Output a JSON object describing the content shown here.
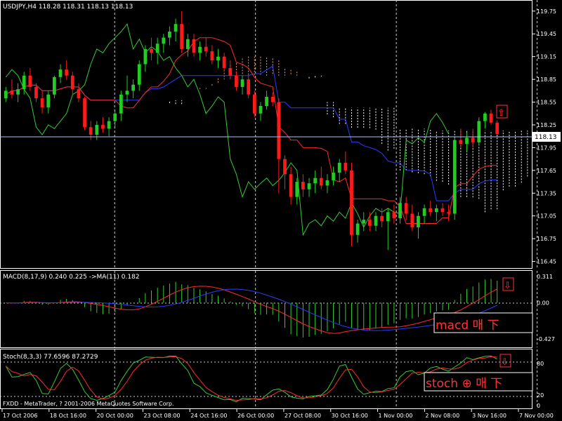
{
  "colors": {
    "background": "#000000",
    "frame": "#ffffff",
    "bull": "#22cc22",
    "bear": "#ff1a1a",
    "tenkan": "#ff2a2a",
    "kijun": "#2a3cff",
    "chikou": "#33cc33",
    "cloud_a": "#e8a070",
    "cloud_b": "#ffffff",
    "macd_hist": "#33cc33",
    "macd_signal": "#ff2a2a",
    "stoch_main": "#33cc33",
    "stoch_signal": "#ff2a2a",
    "grid": "#cccccc",
    "annotation": "#ff3333",
    "current_line": "#aac4ff"
  },
  "header": {
    "main": "USDJPY,H4  118.28 118.31 118.13 118.13",
    "macd": "MACD(8,17,9) 0.240 0.225  ->MA(11) 0.182",
    "stoch": "Stoch(8,3,3) 77.6596 87.2729",
    "copyright": "FXDD - MetaTrader, ? 2001-2006 MetaQuotes Software Corp."
  },
  "annotations": {
    "macd_text": "macd 매 下 ",
    "stoch_text": "stoch ⊕ 매 下 ",
    "main_arrow": "⇧",
    "macd_arrow": "⇩",
    "stoch_arrow": "⇩"
  },
  "current_price": "118.13",
  "chart_data": [
    {
      "type": "candlestick",
      "title": "USDJPY,H4",
      "symbol": "USDJPY",
      "timeframe": "H4",
      "last_bar": {
        "open": 118.28,
        "high": 118.31,
        "low": 118.13,
        "close": 118.13
      },
      "ylim": [
        116.4,
        119.85
      ],
      "y_ticks": [
        "119.75",
        "119.45",
        "119.15",
        "118.85",
        "118.55",
        "118.25",
        "117.95",
        "117.65",
        "117.35",
        "117.05",
        "116.75",
        "116.45"
      ],
      "x_ticks": [
        "17 Oct 2006",
        "18 Oct 16:00",
        "20 Oct 00:00",
        "23 Oct 08:00",
        "24 Oct 16:00",
        "26 Oct 00:00",
        "27 Oct 08:00",
        "30 Oct 16:00",
        "1 Nov 00:00",
        "2 Nov 08:00",
        "3 Nov 16:00",
        "7 Nov 00:00"
      ],
      "grid": "vertical separators only",
      "candles": [
        [
          118.6,
          118.75,
          118.55,
          118.7
        ],
        [
          118.7,
          118.85,
          118.6,
          118.65
        ],
        [
          118.65,
          118.8,
          118.55,
          118.72
        ],
        [
          118.72,
          118.95,
          118.65,
          118.9
        ],
        [
          118.9,
          119.0,
          118.7,
          118.75
        ],
        [
          118.75,
          118.8,
          118.55,
          118.6
        ],
        [
          118.6,
          118.7,
          118.4,
          118.48
        ],
        [
          118.48,
          118.7,
          118.4,
          118.65
        ],
        [
          118.65,
          118.9,
          118.6,
          118.88
        ],
        [
          118.88,
          119.05,
          118.8,
          118.98
        ],
        [
          118.98,
          119.1,
          118.85,
          118.9
        ],
        [
          118.9,
          118.95,
          118.65,
          118.72
        ],
        [
          118.72,
          118.8,
          118.55,
          118.6
        ],
        [
          118.6,
          118.62,
          118.18,
          118.22
        ],
        [
          118.22,
          118.3,
          118.05,
          118.12
        ],
        [
          118.12,
          118.3,
          118.05,
          118.25
        ],
        [
          118.25,
          118.35,
          118.15,
          118.2
        ],
        [
          118.2,
          118.35,
          118.1,
          118.3
        ],
        [
          118.3,
          118.45,
          118.2,
          118.4
        ],
        [
          118.4,
          118.7,
          118.3,
          118.65
        ],
        [
          118.65,
          118.9,
          118.55,
          118.7
        ],
        [
          118.7,
          118.85,
          118.6,
          118.78
        ],
        [
          118.78,
          119.1,
          118.7,
          119.05
        ],
        [
          119.05,
          119.3,
          118.95,
          119.25
        ],
        [
          119.25,
          119.4,
          119.1,
          119.2
        ],
        [
          119.2,
          119.4,
          119.05,
          119.32
        ],
        [
          119.32,
          119.45,
          119.2,
          119.4
        ],
        [
          119.4,
          119.55,
          119.3,
          119.48
        ],
        [
          119.48,
          119.65,
          119.35,
          119.58
        ],
        [
          119.58,
          119.75,
          119.2,
          119.25
        ],
        [
          119.25,
          119.45,
          119.15,
          119.38
        ],
        [
          119.38,
          119.45,
          119.15,
          119.2
        ],
        [
          119.2,
          119.35,
          119.1,
          119.28
        ],
        [
          119.28,
          119.4,
          119.15,
          119.22
        ],
        [
          119.22,
          119.3,
          119.05,
          119.1
        ],
        [
          119.1,
          119.25,
          119.0,
          119.15
        ],
        [
          119.15,
          119.2,
          118.95,
          119.0
        ],
        [
          119.0,
          119.1,
          118.85,
          118.9
        ],
        [
          118.9,
          118.95,
          118.7,
          118.75
        ],
        [
          118.75,
          118.9,
          118.65,
          118.85
        ],
        [
          118.85,
          118.9,
          118.6,
          118.65
        ],
        [
          118.65,
          118.7,
          118.35,
          118.4
        ],
        [
          118.4,
          118.55,
          118.3,
          118.5
        ],
        [
          118.5,
          118.7,
          118.45,
          118.62
        ],
        [
          118.62,
          118.68,
          118.5,
          118.55
        ],
        [
          118.55,
          118.6,
          117.35,
          117.8
        ],
        [
          117.8,
          117.85,
          117.4,
          117.6
        ],
        [
          117.6,
          117.7,
          117.2,
          117.3
        ],
        [
          117.3,
          117.55,
          117.2,
          117.5
        ],
        [
          117.5,
          117.6,
          117.3,
          117.4
        ],
        [
          117.4,
          117.55,
          117.3,
          117.48
        ],
        [
          117.48,
          117.65,
          117.35,
          117.55
        ],
        [
          117.55,
          117.7,
          117.4,
          117.45
        ],
        [
          117.45,
          117.6,
          117.35,
          117.52
        ],
        [
          117.52,
          117.7,
          117.45,
          117.62
        ],
        [
          117.62,
          117.8,
          117.5,
          117.75
        ],
        [
          117.75,
          117.9,
          117.6,
          117.65
        ],
        [
          117.65,
          117.75,
          116.65,
          116.8
        ],
        [
          116.8,
          117.0,
          116.7,
          116.95
        ],
        [
          116.95,
          117.1,
          116.85,
          117.0
        ],
        [
          117.0,
          117.1,
          116.85,
          116.92
        ],
        [
          116.92,
          117.1,
          116.85,
          117.05
        ],
        [
          117.05,
          117.15,
          116.9,
          116.98
        ],
        [
          116.98,
          117.15,
          116.6,
          117.1
        ],
        [
          117.1,
          117.2,
          116.95,
          117.02
        ],
        [
          117.02,
          117.3,
          116.95,
          117.22
        ],
        [
          117.22,
          117.3,
          117.0,
          117.08
        ],
        [
          117.08,
          117.2,
          116.85,
          116.9
        ],
        [
          116.9,
          117.1,
          116.75,
          117.05
        ],
        [
          117.05,
          117.2,
          116.95,
          117.15
        ],
        [
          117.15,
          117.25,
          117.05,
          117.1
        ],
        [
          117.1,
          117.2,
          116.98,
          117.15
        ],
        [
          117.15,
          117.22,
          117.05,
          117.1
        ],
        [
          117.1,
          117.2,
          116.98,
          117.08
        ],
        [
          117.08,
          118.1,
          117.0,
          118.05
        ],
        [
          118.05,
          118.2,
          117.95,
          118.0
        ],
        [
          118.0,
          118.15,
          117.9,
          118.08
        ],
        [
          118.08,
          118.2,
          117.95,
          118.02
        ],
        [
          118.02,
          118.35,
          117.98,
          118.3
        ],
        [
          118.3,
          118.42,
          118.2,
          118.4
        ],
        [
          118.4,
          118.45,
          118.25,
          118.28
        ],
        [
          118.28,
          118.31,
          118.13,
          118.13
        ]
      ]
    },
    {
      "type": "line+histogram",
      "title": "MACD(8,17,9) 0.240 0.225  ->MA(11) 0.182",
      "ylim": [
        -0.5,
        0.36
      ],
      "y_ticks": [
        "0.311",
        "0.00",
        "-0.427"
      ],
      "series": [
        {
          "name": "MACD(8,17,9)",
          "style": "histogram",
          "values": [
            0.24
          ]
        },
        {
          "name": "Signal",
          "style": "line",
          "values": [
            0.225
          ]
        },
        {
          "name": "MA(11)",
          "style": "line",
          "values": [
            0.182
          ]
        }
      ]
    },
    {
      "type": "line",
      "title": "Stoch(8,3,3) 77.6596 87.2729",
      "ylim": [
        0,
        100
      ],
      "y_ticks": [
        "80",
        "20",
        "0"
      ],
      "levels": [
        80,
        20
      ],
      "series": [
        {
          "name": "Stoch main",
          "values": [
            77.6596
          ]
        },
        {
          "name": "Stoch signal",
          "values": [
            87.2729
          ]
        }
      ]
    }
  ]
}
